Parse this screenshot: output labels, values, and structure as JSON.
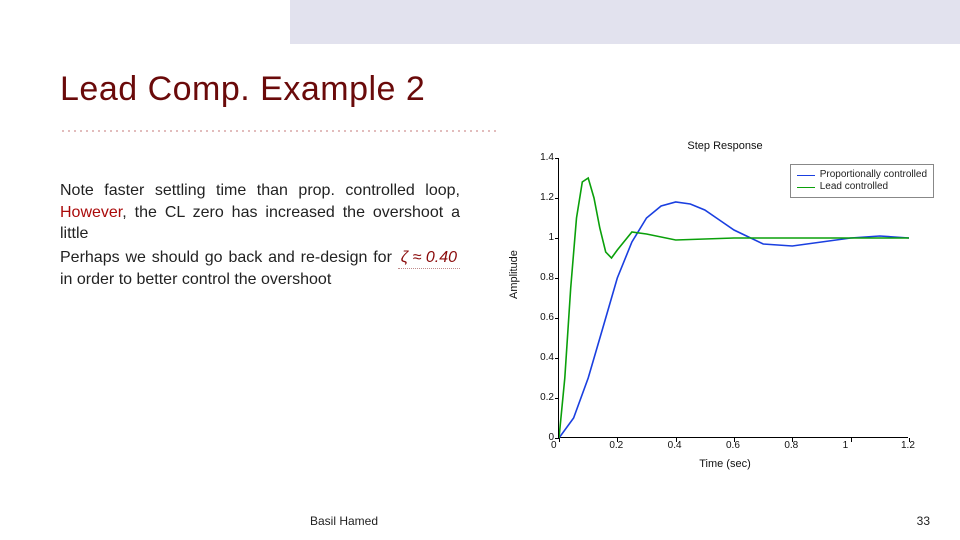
{
  "title": "Lead Comp. Example 2",
  "body": {
    "p1a": "Note faster settling time than prop. controlled loop, ",
    "p1red": "However",
    "p1b": ", the CL zero has increased the overshoot a little",
    "p2a": "Perhaps we should go back and re-design for ",
    "zeta": "ζ ≈ 0.40",
    "p2b": " in order to better control the overshoot"
  },
  "chart_data": {
    "type": "line",
    "title": "Step Response",
    "xlabel": "Time (sec)",
    "ylabel": "Amplitude",
    "xlim": [
      0,
      1.2
    ],
    "ylim": [
      0,
      1.4
    ],
    "xticks": [
      0,
      0.2,
      0.4,
      0.6,
      0.8,
      1,
      1.2
    ],
    "yticks": [
      0,
      0.2,
      0.4,
      0.6,
      0.8,
      1,
      1.2,
      1.4
    ],
    "series": [
      {
        "name": "Proportionally controlled",
        "color": "#1a3fe0",
        "x": [
          0,
          0.05,
          0.1,
          0.15,
          0.2,
          0.25,
          0.3,
          0.35,
          0.4,
          0.45,
          0.5,
          0.55,
          0.6,
          0.7,
          0.8,
          0.9,
          1.0,
          1.1,
          1.2
        ],
        "y": [
          0,
          0.1,
          0.3,
          0.55,
          0.8,
          0.98,
          1.1,
          1.16,
          1.18,
          1.17,
          1.14,
          1.09,
          1.04,
          0.97,
          0.96,
          0.98,
          1.0,
          1.01,
          1.0
        ]
      },
      {
        "name": "Lead controlled",
        "color": "#0aa00a",
        "x": [
          0,
          0.02,
          0.04,
          0.06,
          0.08,
          0.1,
          0.12,
          0.14,
          0.16,
          0.18,
          0.2,
          0.25,
          0.3,
          0.4,
          0.6,
          0.8,
          1.0,
          1.2
        ],
        "y": [
          0,
          0.3,
          0.75,
          1.1,
          1.28,
          1.3,
          1.2,
          1.05,
          0.93,
          0.9,
          0.94,
          1.03,
          1.02,
          0.99,
          1.0,
          1.0,
          1.0,
          1.0
        ]
      }
    ]
  },
  "footer": {
    "author": "Basil Hamed",
    "page": "33"
  }
}
